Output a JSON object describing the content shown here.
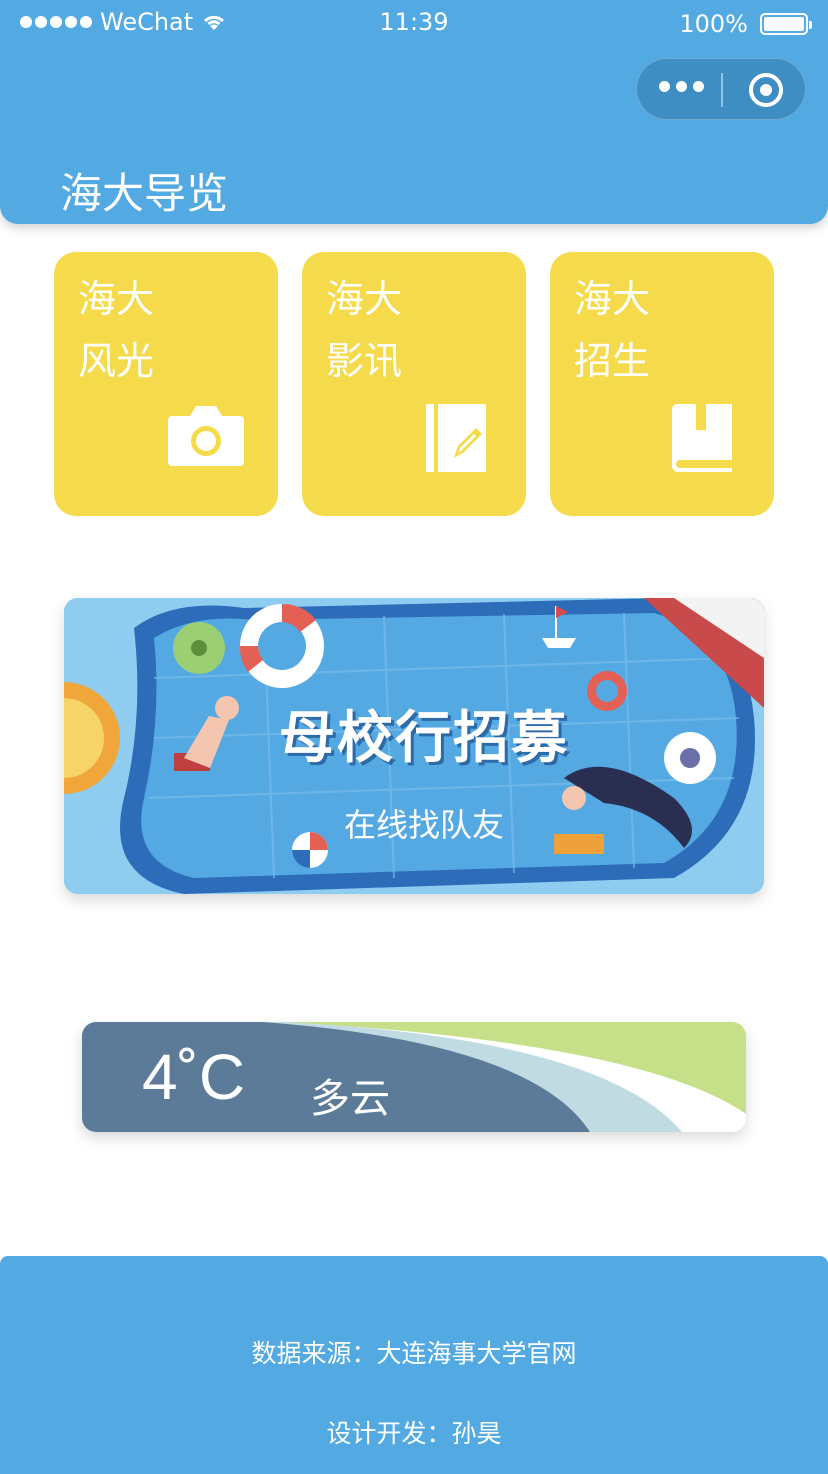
{
  "status_bar": {
    "carrier": "WeChat",
    "time": "11:39",
    "battery": "100%"
  },
  "header": {
    "title": "海大导览"
  },
  "cards": [
    {
      "line1": "海大",
      "line2": "风光",
      "icon": "camera-icon"
    },
    {
      "line1": "海大",
      "line2": "影讯",
      "icon": "notebook-edit-icon"
    },
    {
      "line1": "海大",
      "line2": "招生",
      "icon": "book-icon"
    }
  ],
  "banner": {
    "title": "母校行招募",
    "subtitle": "在线找队友"
  },
  "weather": {
    "temperature": "4˚C",
    "condition": "多云"
  },
  "footer": {
    "source": "数据来源：大连海事大学官网",
    "developer": "设计开发：孙昊"
  },
  "colors": {
    "primary_blue": "#53a9e1",
    "card_yellow": "#f5da4b",
    "weather_slate": "#5b7b98"
  }
}
